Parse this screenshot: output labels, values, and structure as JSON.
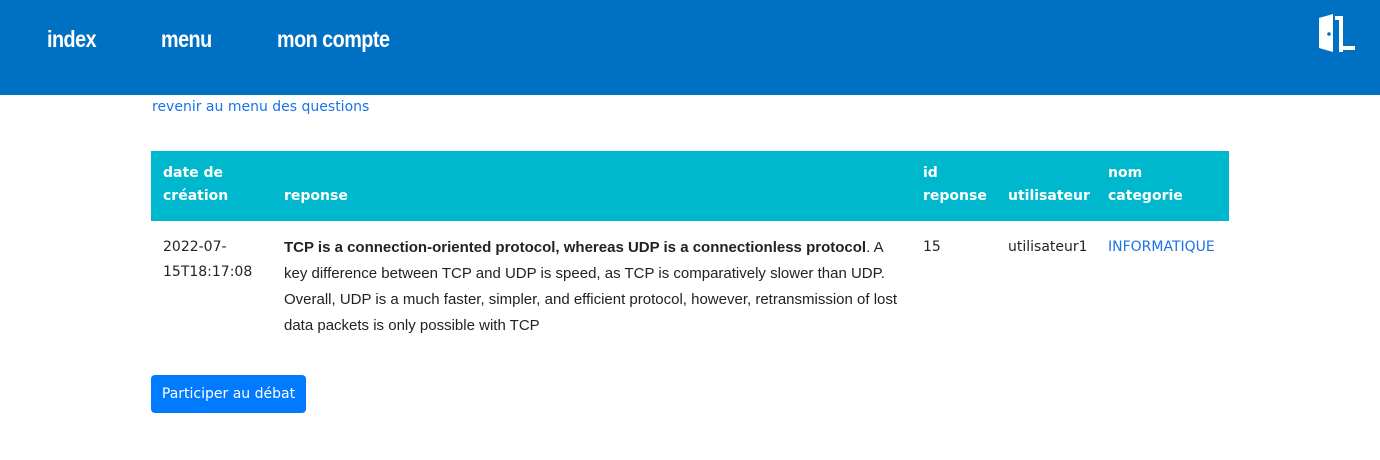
{
  "nav": {
    "items": [
      {
        "label": "index"
      },
      {
        "label": "menu"
      },
      {
        "label": "mon compte"
      }
    ],
    "logout_icon": "door-exit-icon"
  },
  "back_link": "revenir au menu des questions",
  "table": {
    "headers": {
      "date": "date de création",
      "reponse": "reponse",
      "id": "id reponse",
      "user": "utilisateur",
      "category": "nom categorie"
    },
    "rows": [
      {
        "date": "2022-07-15T18:17:08",
        "reponse_bold": "TCP is a connection-oriented protocol, whereas UDP is a connectionless protocol",
        "reponse_rest": ". A key difference between TCP and UDP is speed, as TCP is comparatively slower than UDP. Overall, UDP is a much faster, simpler, and efficient protocol, however, retransmission of lost data packets is only possible with TCP",
        "id": "15",
        "user": "utilisateur1",
        "category": "INFORMATIQUE"
      }
    ]
  },
  "participate_button": "Participer au débat",
  "colors": {
    "navbar": "#0070c3",
    "table_header": "#00b8cd",
    "link": "#1a73e8",
    "button": "#007bff"
  }
}
